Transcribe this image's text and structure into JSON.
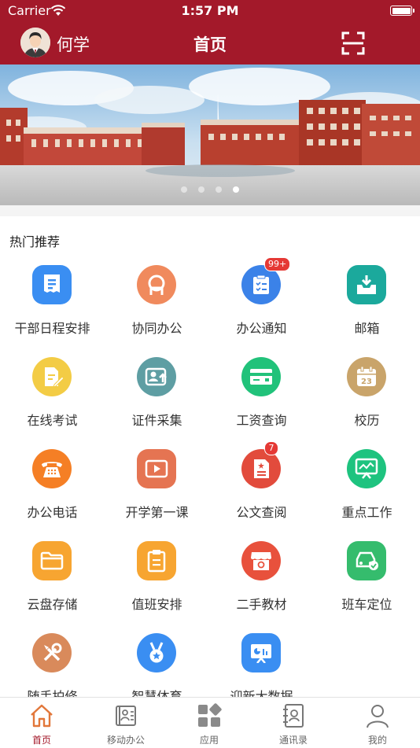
{
  "status_bar": {
    "carrier": "Carrier",
    "time": "1:57 PM"
  },
  "nav": {
    "username": "何学",
    "title": "首页"
  },
  "banner": {
    "page_count": 4,
    "active_index": 3
  },
  "section": {
    "title": "热门推荐"
  },
  "apps": [
    {
      "label": "干部日程安排",
      "icon": "schedule-icon",
      "color": "#3a8ef2",
      "badge": ""
    },
    {
      "label": "协同办公",
      "icon": "collab-icon",
      "color": "#f08a5d",
      "badge": ""
    },
    {
      "label": "办公通知",
      "icon": "notice-icon",
      "color": "#3b82e8",
      "badge": "99+"
    },
    {
      "label": "邮箱",
      "icon": "mailbox-icon",
      "color": "#1ba99c",
      "badge": ""
    },
    {
      "label": "在线考试",
      "icon": "exam-icon",
      "color": "#f3cc45",
      "badge": ""
    },
    {
      "label": "证件采集",
      "icon": "id-capture-icon",
      "color": "#5e9ea3",
      "badge": ""
    },
    {
      "label": "工资查询",
      "icon": "salary-card-icon",
      "color": "#21c27a",
      "badge": ""
    },
    {
      "label": "校历",
      "icon": "calendar-icon",
      "color": "#c9a46a",
      "badge": ""
    },
    {
      "label": "办公电话",
      "icon": "phone-icon",
      "color": "#f57f25",
      "badge": ""
    },
    {
      "label": "开学第一课",
      "icon": "video-icon",
      "color": "#e57452",
      "badge": ""
    },
    {
      "label": "公文查阅",
      "icon": "document-icon",
      "color": "#e24b3c",
      "badge": "7"
    },
    {
      "label": "重点工作",
      "icon": "monitor-icon",
      "color": "#1ec37f",
      "badge": ""
    },
    {
      "label": "云盘存储",
      "icon": "folder-icon",
      "color": "#f7a531",
      "badge": ""
    },
    {
      "label": "值班安排",
      "icon": "clipboard-icon",
      "color": "#f7a531",
      "badge": ""
    },
    {
      "label": "二手教材",
      "icon": "store-icon",
      "color": "#e8513c",
      "badge": ""
    },
    {
      "label": "班车定位",
      "icon": "bus-icon",
      "color": "#35bc6d",
      "badge": ""
    },
    {
      "label": "随手拍修",
      "icon": "tools-icon",
      "color": "#d98a5b",
      "badge": ""
    },
    {
      "label": "智慧体育",
      "icon": "medal-icon",
      "color": "#3a8ef2",
      "badge": ""
    },
    {
      "label": "迎新大数据",
      "icon": "data-screen-icon",
      "color": "#3a8ef2",
      "badge": ""
    }
  ],
  "tabs": [
    {
      "label": "首页",
      "icon": "home-icon",
      "active": true
    },
    {
      "label": "移动办公",
      "icon": "office-icon",
      "active": false
    },
    {
      "label": "应用",
      "icon": "apps-icon",
      "active": false
    },
    {
      "label": "通讯录",
      "icon": "contacts-icon",
      "active": false
    },
    {
      "label": "我的",
      "icon": "profile-icon",
      "active": false
    }
  ],
  "colors": {
    "brand": "#a3192a",
    "tab_active": "#a3192a",
    "tab_inactive": "#666666",
    "badge": "#e53935"
  }
}
